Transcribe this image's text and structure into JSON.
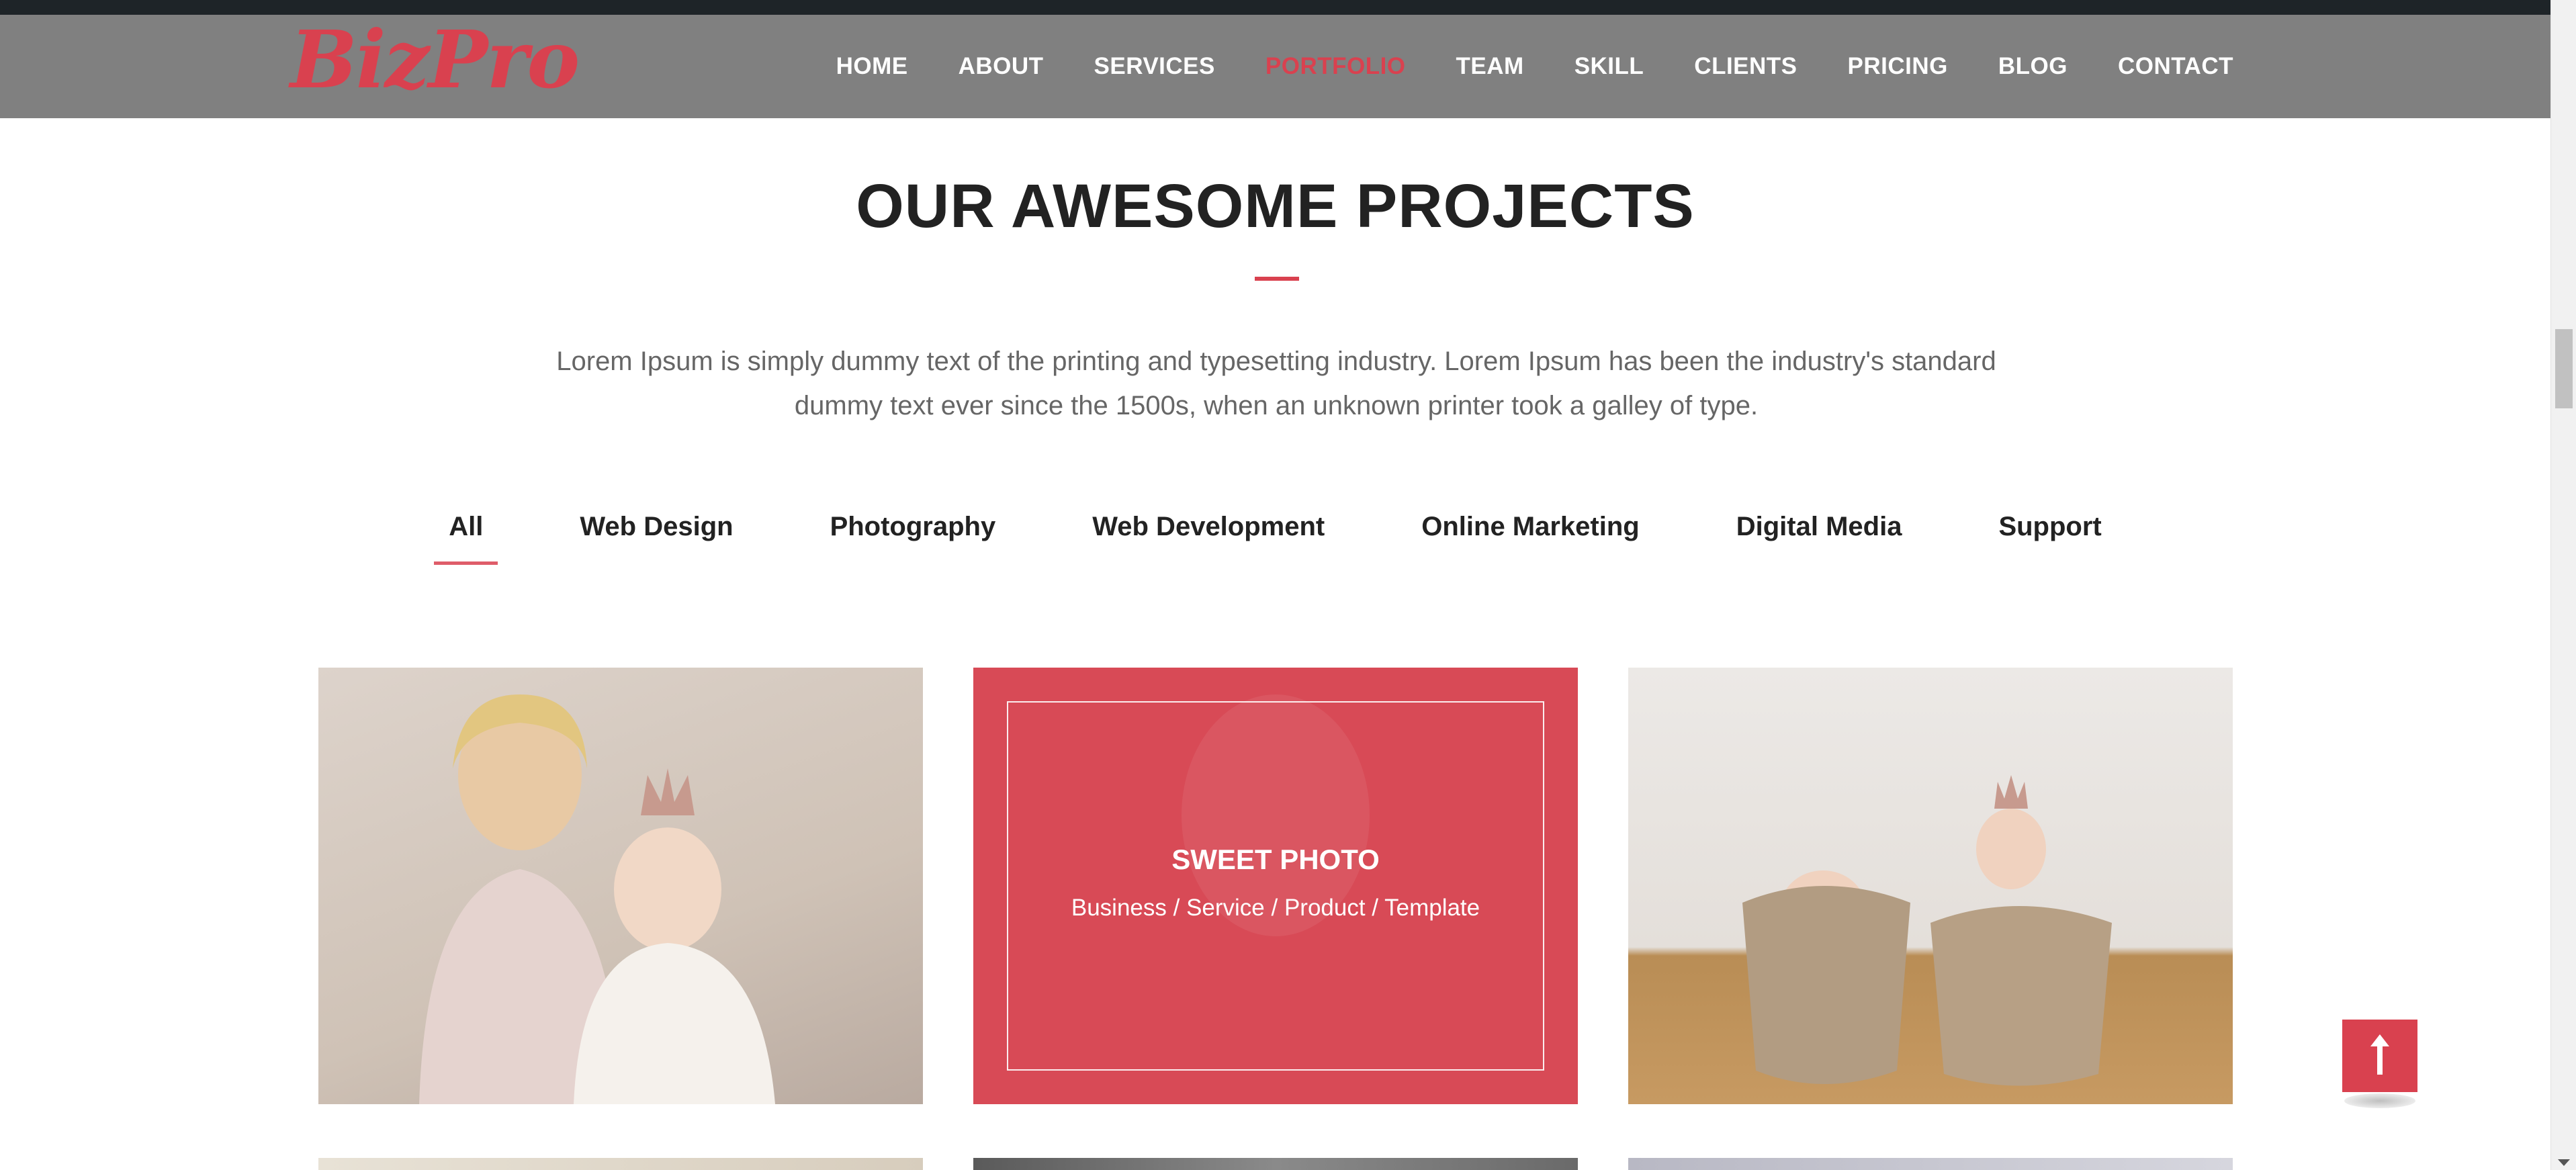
{
  "brand": {
    "logo_text": "BizPro",
    "accent_color": "#d9414f"
  },
  "nav": {
    "items": [
      {
        "label": "HOME"
      },
      {
        "label": "ABOUT"
      },
      {
        "label": "SERVICES"
      },
      {
        "label": "PORTFOLIO",
        "active": true
      },
      {
        "label": "TEAM"
      },
      {
        "label": "SKILL"
      },
      {
        "label": "CLIENTS"
      },
      {
        "label": "PRICING"
      },
      {
        "label": "BLOG"
      },
      {
        "label": "CONTACT"
      }
    ]
  },
  "portfolio": {
    "title": "OUR AWESOME PROJECTS",
    "lead": "Lorem Ipsum is simply dummy text of the printing and typesetting industry. Lorem Ipsum has been the industry's standard dummy text ever since the 1500s, when an unknown printer took a galley of type.",
    "filters": [
      {
        "label": "All",
        "active": true
      },
      {
        "label": "Web Design"
      },
      {
        "label": "Photography"
      },
      {
        "label": "Web Development"
      },
      {
        "label": "Online Marketing"
      },
      {
        "label": "Digital Media"
      },
      {
        "label": "Support"
      }
    ],
    "hover_card": {
      "title": "SWEET PHOTO",
      "subtitle": "Business / Service / Product / Template"
    },
    "cards": [
      {
        "image": "grandmother-with-baby-photo"
      },
      {
        "image": "girl-portrait-photo"
      },
      {
        "image": "children-in-bags-photo"
      }
    ]
  },
  "icons": {
    "back_to_top": "arrow-up-icon"
  }
}
